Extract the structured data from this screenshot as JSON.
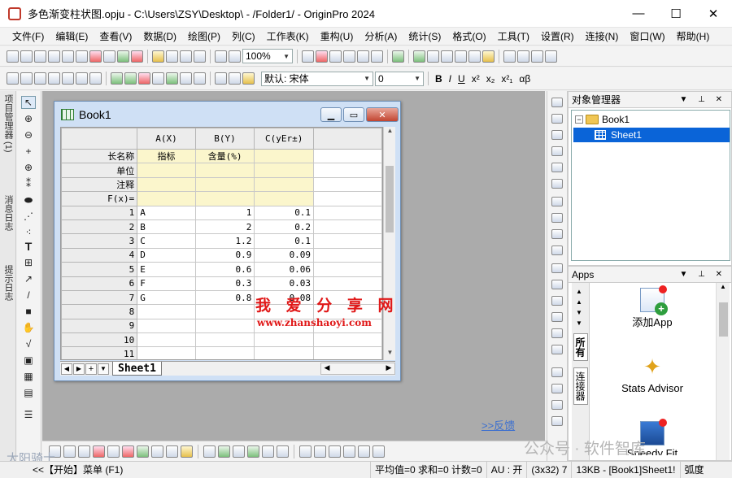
{
  "window": {
    "title": "多色渐变柱状图.opju - C:\\Users\\ZSY\\Desktop\\ - /Folder1/ - OriginPro 2024",
    "controls": {
      "minimize": "—",
      "maximize": "☐",
      "close": "✕"
    }
  },
  "menu": [
    "文件(F)",
    "编辑(E)",
    "查看(V)",
    "数据(D)",
    "绘图(P)",
    "列(C)",
    "工作表(K)",
    "重构(U)",
    "分析(A)",
    "统计(S)",
    "格式(O)",
    "工具(T)",
    "设置(R)",
    "连接(N)",
    "窗口(W)",
    "帮助(H)"
  ],
  "toolbar": {
    "zoom": "100%",
    "font_name": "默认: 宋体",
    "font_size": "0",
    "format_buttons": [
      "B",
      "I",
      "U",
      "x²",
      "x₂",
      "x²₁",
      "αβ"
    ]
  },
  "left_tabs": [
    "项目管理器 (1)",
    "消息日志",
    "提示日志"
  ],
  "book": {
    "title": "Book1",
    "columns": [
      {
        "header": "A(X)",
        "long_name": "指标",
        "unit": "",
        "comment": ""
      },
      {
        "header": "B(Y)",
        "long_name": "含量(%)",
        "unit": "",
        "comment": ""
      },
      {
        "header": "C(yEr±)",
        "long_name": "",
        "unit": "",
        "comment": ""
      }
    ],
    "meta_labels": [
      "长名称",
      "单位",
      "注释",
      "F(x)="
    ],
    "rows": [
      {
        "n": "1",
        "a": "A",
        "b": "1",
        "c": "0.1"
      },
      {
        "n": "2",
        "a": "B",
        "b": "2",
        "c": "0.2"
      },
      {
        "n": "3",
        "a": "C",
        "b": "1.2",
        "c": "0.1"
      },
      {
        "n": "4",
        "a": "D",
        "b": "0.9",
        "c": "0.09"
      },
      {
        "n": "5",
        "a": "E",
        "b": "0.6",
        "c": "0.06"
      },
      {
        "n": "6",
        "a": "F",
        "b": "0.3",
        "c": "0.03"
      },
      {
        "n": "7",
        "a": "G",
        "b": "0.8",
        "c": "0.08"
      },
      {
        "n": "8",
        "a": "",
        "b": "",
        "c": ""
      },
      {
        "n": "9",
        "a": "",
        "b": "",
        "c": ""
      },
      {
        "n": "10",
        "a": "",
        "b": "",
        "c": ""
      },
      {
        "n": "11",
        "a": "",
        "b": "",
        "c": ""
      }
    ],
    "sheet_tab": "Sheet1"
  },
  "watermark": {
    "cn": "我 爱 分 享 网",
    "url": "www.zhanshaoyi.com",
    "corner": "公众号 · 软件智库",
    "corner_left": "太阳骑士"
  },
  "feedback_link": ">>反馈",
  "object_manager": {
    "title": "对象管理器",
    "book": "Book1",
    "sheet": "Sheet1"
  },
  "apps": {
    "title": "Apps",
    "tabs": [
      "所有",
      "连接器"
    ],
    "items": [
      "添加App",
      "Stats Advisor",
      "Speedy Fit"
    ]
  },
  "status": {
    "start_menu": "<<【开始】菜单 (F1)",
    "summary": "平均值=0 求和=0 计数=0",
    "au": "AU : 开",
    "size": "(3x32) 7",
    "kb": "13KB - [Book1]Sheet1!",
    "unit": "弧度"
  },
  "colors": {
    "meta_row": "#fbf6cc",
    "watermark": "#e01818",
    "selection": "#0a64d8",
    "mdi_bg": "#ababab"
  }
}
